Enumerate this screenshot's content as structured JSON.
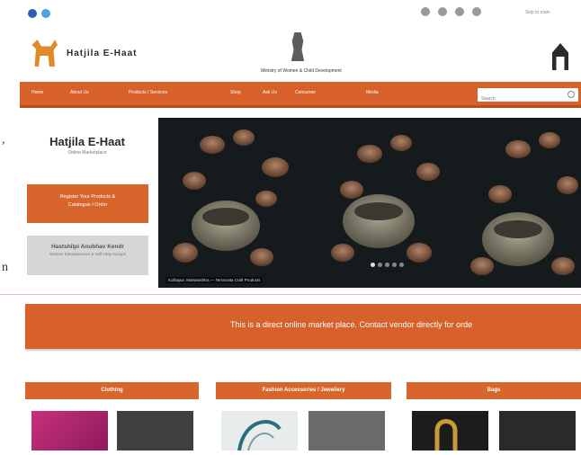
{
  "topbar": {
    "social": [
      "facebook-icon",
      "twitter-icon"
    ],
    "icons": [
      "accessibility-icon",
      "font-size-icon",
      "contrast-icon",
      "language-icon"
    ],
    "link": "Skip to main"
  },
  "header": {
    "site_name": "Hatjila E-Haat",
    "ministry": "Ministry of Women & Child Development"
  },
  "nav": {
    "items": [
      "Home",
      "About Us",
      "Products / Services",
      "Shop",
      "Ask Us",
      "Consumer",
      "Media"
    ],
    "search_placeholder": "Search"
  },
  "sidebar": {
    "title": "Hatjila E-Haat",
    "subtitle": "Online Marketplace",
    "register_lines": [
      "Register Your Products &",
      "Catalogue / Order"
    ],
    "grey_title": "Hastshilpi Anubhav Kendr",
    "grey_sub": "Women Entrepreneurs & Self Help Groups"
  },
  "slider": {
    "caption": "Kolhapur, Maharashtra — Terracotta Craft Products",
    "slide_count": 5,
    "active_slide": 1
  },
  "banner": {
    "text": "This is a direct online market place. Contact vendor directly for orde"
  },
  "categories": [
    "Clothing",
    "Fashion Accessories / Jewellery",
    "Bags"
  ],
  "colors": {
    "accent": "#d8612b",
    "accent_dark": "#b84c1c",
    "grey_button": "#d6d6d6"
  }
}
